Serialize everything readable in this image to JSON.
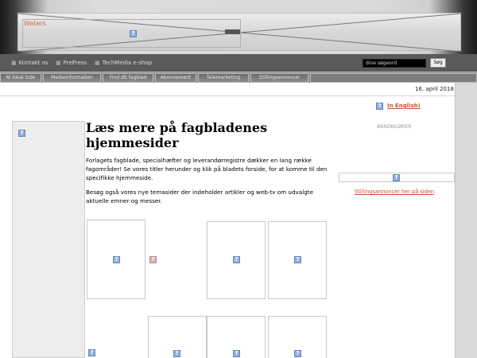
{
  "header": {
    "brand": "Waters",
    "top_links": [
      {
        "label": "Kontakt os",
        "icon": "bullet-icon"
      },
      {
        "label": "PrePress",
        "icon": "bullet-icon"
      },
      {
        "label": "TechMedia e-shop",
        "icon": "bullet-icon"
      }
    ],
    "search": {
      "placeholder": "dine søgeord",
      "button_label": "Søg"
    }
  },
  "nav_tabs": [
    "Ni lokal Side",
    "Medieinformation",
    "Find dit fagblad",
    "Abonnement",
    "Telemarketing",
    "Stillingsannoncer"
  ],
  "date": "16. april 2018",
  "main": {
    "heading": "Læs mere på fagbladenes hjemmesider",
    "paragraph1": "Forlagets fagblade, specialhæfter og leverandørregistre dækker en lang række fagområder! Se vores titler herunder og klik på bladets forside, for at komme til den specifikke hjemmeside.",
    "paragraph2": "Besøg også vores nye temasider der indeholder artikler og web-tv om udvalgte aktuelle emner og messer."
  },
  "sidebar": {
    "english_link": "In English!",
    "ads_label": "ANNONCØRER",
    "jobs_link": "Stillingsannoncer her på siden"
  },
  "icons": {
    "broken_image": "broken-image-icon",
    "flag": "uk-flag-icon"
  },
  "colors": {
    "link": "#c8542a",
    "nav_bg": "#5a5a5a",
    "tab_bg": "#7c7c7c"
  }
}
